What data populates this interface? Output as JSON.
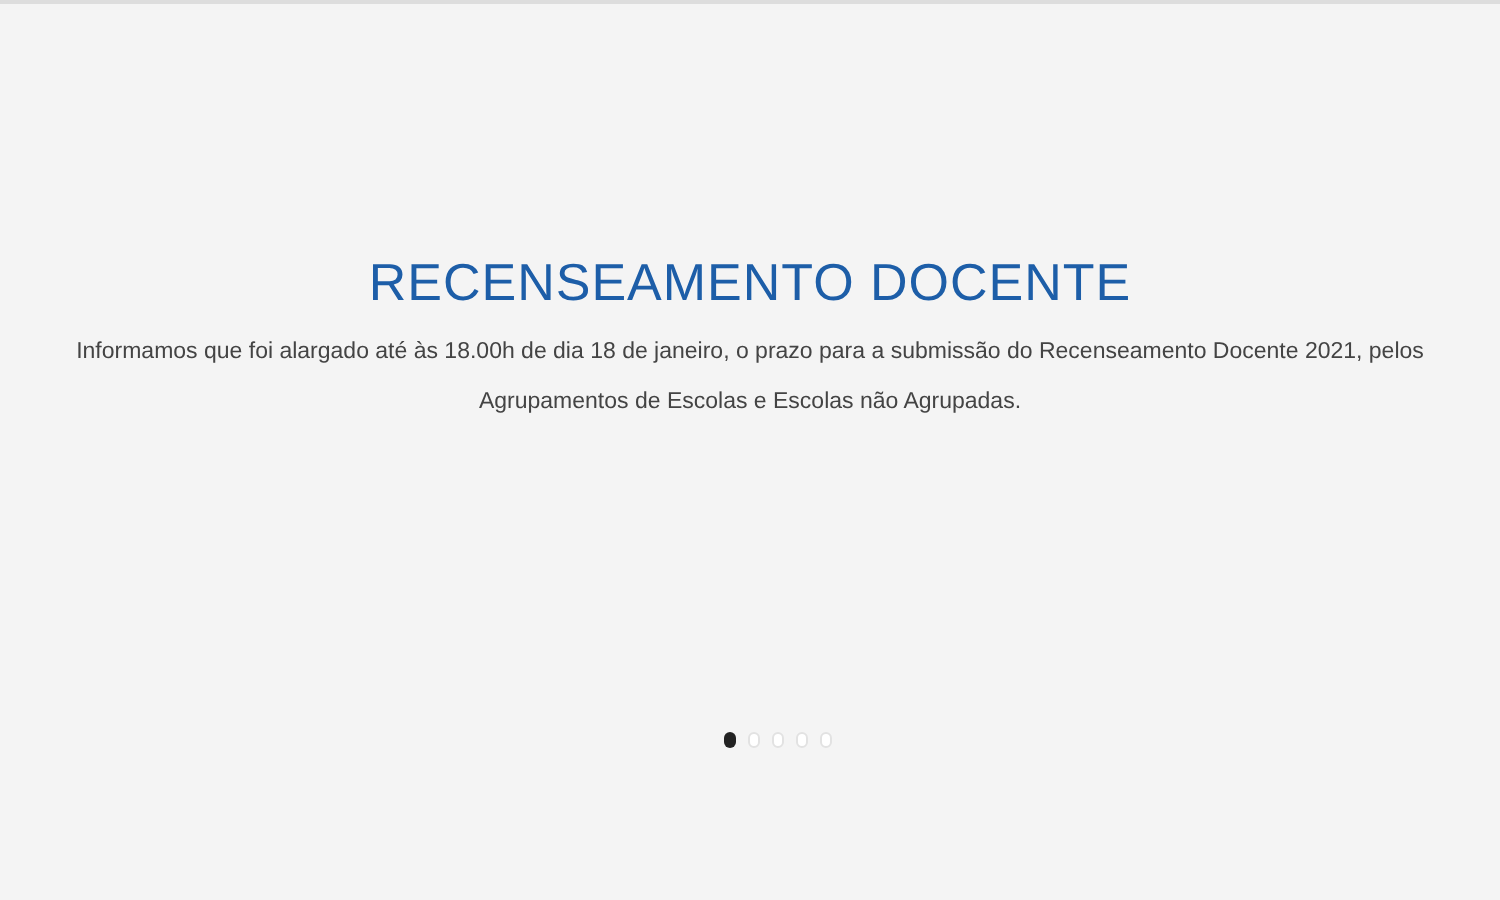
{
  "slide": {
    "title": "RECENSEAMENTO DOCENTE",
    "text": "Informamos que foi alargado até às 18.00h de dia 18 de janeiro, o prazo para a submissão do Recenseamento Docente 2021, pelos Agrupamentos de Escolas e Escolas não Agrupadas."
  },
  "pager": [
    {
      "selected": true
    },
    {
      "selected": false
    },
    {
      "selected": false
    },
    {
      "selected": false
    },
    {
      "selected": false
    }
  ]
}
